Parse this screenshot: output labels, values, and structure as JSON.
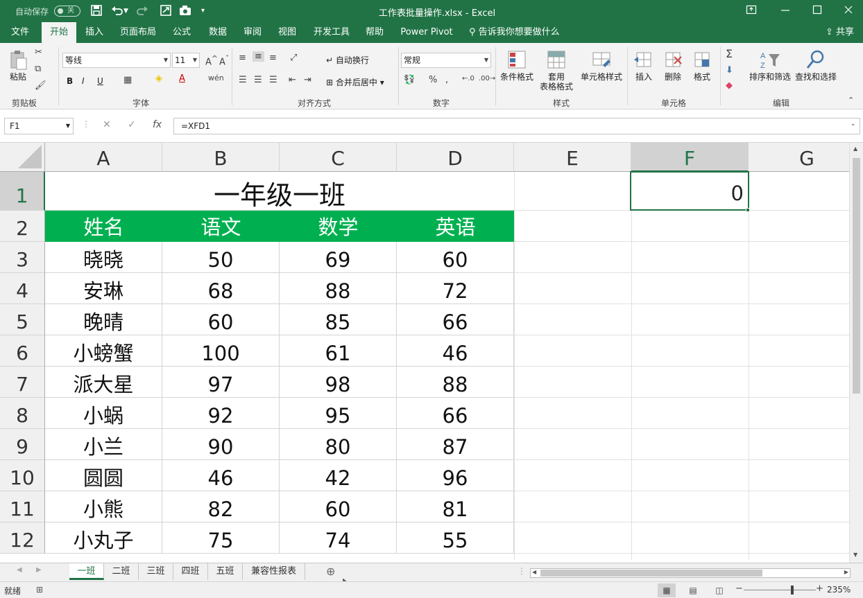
{
  "titlebar": {
    "autosave_label": "自动保存",
    "autosave_state": "关",
    "file_title": "工作表批量操作.xlsx  -  Excel"
  },
  "ribbon_tabs": [
    "文件",
    "开始",
    "插入",
    "页面布局",
    "公式",
    "数据",
    "审阅",
    "视图",
    "开发工具",
    "帮助",
    "Power Pivot"
  ],
  "active_tab": "开始",
  "tell_me": "告诉我你想要做什么",
  "share": "共享",
  "ribbon": {
    "paste": "粘贴",
    "groups": {
      "clipboard": "剪贴板",
      "font": "字体",
      "alignment": "对齐方式",
      "number": "数字",
      "styles": "样式",
      "cells": "单元格",
      "editing": "编辑"
    },
    "font_name": "等线",
    "font_size": "11",
    "bold": "B",
    "italic": "I",
    "underline": "U",
    "wrap_text": "自动换行",
    "merge_center": "合并后居中",
    "number_format": "常规",
    "conditional_format": "条件格式",
    "table_format_1": "套用",
    "table_format_2": "表格格式",
    "cell_styles": "单元格样式",
    "insert": "插入",
    "delete": "删除",
    "format": "格式",
    "sort_filter": "排序和筛选",
    "find_select": "查找和选择"
  },
  "formula_bar": {
    "name_box": "F1",
    "formula": "=XFD1"
  },
  "columns": [
    "A",
    "B",
    "C",
    "D",
    "E",
    "F",
    "G"
  ],
  "selected_column": "F",
  "rows": [
    "1",
    "2",
    "3",
    "4",
    "5",
    "6",
    "7",
    "8",
    "9",
    "10",
    "11",
    "12"
  ],
  "selected_row": "1",
  "sheet": {
    "title": "一年级一班",
    "headers": [
      "姓名",
      "语文",
      "数学",
      "英语"
    ],
    "records": [
      [
        "晓晓",
        "50",
        "69",
        "60"
      ],
      [
        "安琳",
        "68",
        "88",
        "72"
      ],
      [
        "晚晴",
        "60",
        "85",
        "66"
      ],
      [
        "小螃蟹",
        "100",
        "61",
        "46"
      ],
      [
        "派大星",
        "97",
        "98",
        "88"
      ],
      [
        "小蜗",
        "92",
        "95",
        "66"
      ],
      [
        "小兰",
        "90",
        "80",
        "87"
      ],
      [
        "圆圆",
        "46",
        "42",
        "96"
      ],
      [
        "小熊",
        "82",
        "60",
        "81"
      ],
      [
        "小丸子",
        "75",
        "74",
        "55"
      ]
    ],
    "f1_value": "0",
    "header_fill": "#00B050"
  },
  "sheet_tabs": [
    "一班",
    "二班",
    "三班",
    "四班",
    "五班",
    "兼容性报表"
  ],
  "active_sheet": "一班",
  "status": {
    "ready": "就绪",
    "zoom": "235%"
  },
  "accent_color": "#217346"
}
